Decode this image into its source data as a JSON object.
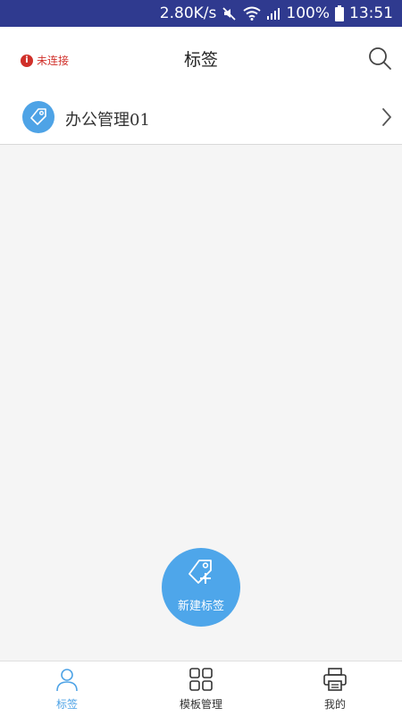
{
  "status_bar": {
    "speed": "2.80K/s",
    "battery": "100%",
    "time": "13:51"
  },
  "header": {
    "connection_status": "未连接",
    "title": "标签"
  },
  "list": {
    "items": [
      {
        "label": "办公管理01"
      }
    ]
  },
  "fab": {
    "label": "新建标签"
  },
  "bottom_nav": {
    "items": [
      {
        "label": "标签",
        "icon": "person-icon",
        "active": true
      },
      {
        "label": "模板管理",
        "icon": "grid-icon",
        "active": false
      },
      {
        "label": "我的",
        "icon": "printer-icon",
        "active": false
      }
    ]
  },
  "colors": {
    "status_bar": "#2f3a8f",
    "accent": "#4ea3e6",
    "error": "#d0302a"
  }
}
